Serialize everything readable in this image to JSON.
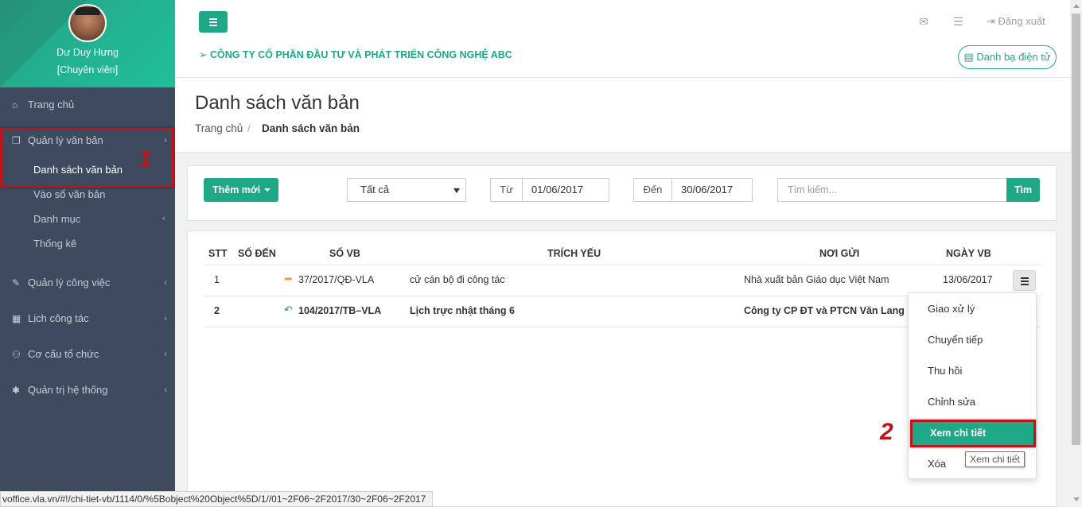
{
  "profile": {
    "name": "Dư Duy Hưng",
    "role": "[Chuyên viên]"
  },
  "sidebar": {
    "items": [
      {
        "label": "Trang chủ",
        "icon": "home-icon"
      },
      {
        "label": "Quản lý văn bản",
        "icon": "documents-icon"
      },
      {
        "label": "Quản lý công việc",
        "icon": "edit-icon"
      },
      {
        "label": "Lịch công tác",
        "icon": "calendar-icon"
      },
      {
        "label": "Cơ cấu tổ chức",
        "icon": "org-chart-icon"
      },
      {
        "label": "Quản trị hệ thống",
        "icon": "gear-icon"
      }
    ],
    "subitems": [
      {
        "label": "Danh sách văn bản"
      },
      {
        "label": "Vào sổ văn bản"
      },
      {
        "label": "Danh mục"
      },
      {
        "label": "Thống kê"
      }
    ]
  },
  "annotations": {
    "step1": "1",
    "step2": "2",
    "color": "#c0141a"
  },
  "header": {
    "company": "CÔNG TY CỔ PHẦN ĐẦU TƯ VÀ PHÁT TRIỂN CÔNG NGHỆ ABC",
    "logout": "Đăng xuất",
    "directory": "Danh bạ điện tử",
    "accent": "#1ea888"
  },
  "page": {
    "title": "Danh sách văn bản",
    "breadcrumb_home": "Trang chủ",
    "breadcrumb_sep": "/",
    "breadcrumb_current": "Danh sách văn bản"
  },
  "filters": {
    "add_label": "Thêm mới",
    "type_selected": "Tất cả",
    "from_label": "Từ",
    "from_value": "01/06/2017",
    "to_label": "Đến",
    "to_value": "30/06/2017",
    "search_placeholder": "Tìm kiếm...",
    "search_button": "Tìm"
  },
  "table": {
    "headers": [
      "STT",
      "SỐ ĐẾN",
      "SỐ VB",
      "TRÍCH YẾU",
      "NƠI GỬI",
      "NGÀY VB"
    ],
    "rows": [
      {
        "stt": "1",
        "so_den": "",
        "so_vb": "37/2017/QĐ-VLA",
        "trich_yeu": "cử cán bộ đi công tác",
        "noi_gui": "Nhà xuất bản Giáo dục Việt Nam",
        "ngay_vb": "13/06/2017",
        "bold": false,
        "icon": "forward-arrow-icon"
      },
      {
        "stt": "2",
        "so_den": "",
        "so_vb": "104/2017/TB–VLA",
        "trich_yeu": "Lịch trực nhật tháng 6",
        "noi_gui": "Công ty CP ĐT và PTCN Văn Lang",
        "ngay_vb": "",
        "bold": true,
        "icon": "reply-arrow-icon"
      }
    ]
  },
  "row_menu": {
    "items": [
      "Giao xử lý",
      "Chuyển tiếp",
      "Thu hồi",
      "Chỉnh sửa",
      "Xem chi tiết",
      "Xóa"
    ],
    "active_index": 4,
    "tooltip": "Xem chi tiết"
  },
  "statusbar": {
    "url": "voffice.vla.vn/#!/chi-tiet-vb/1114/0/%5Bobject%20Object%5D/1//01~2F06~2F2017/30~2F06~2F2017"
  }
}
